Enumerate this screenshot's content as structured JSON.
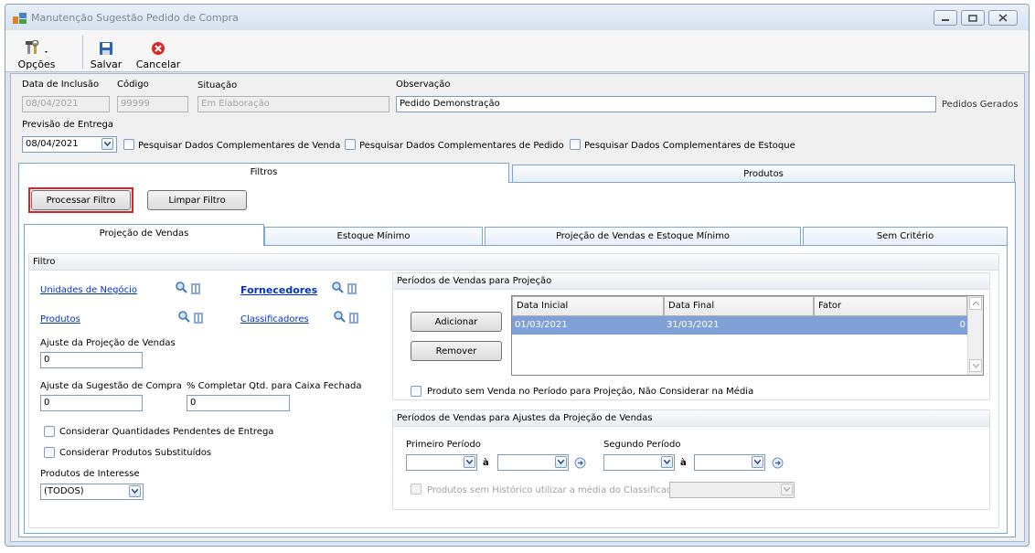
{
  "window": {
    "title": "Manutenção Sugestão Pedido de Compra"
  },
  "toolbar": {
    "options_label": "Opções",
    "save_label": "Salvar",
    "cancel_label": "Cancelar"
  },
  "header": {
    "inclusion_date_label": "Data de Inclusão",
    "inclusion_date_value": "08/04/2021",
    "code_label": "Código",
    "code_value": "99999",
    "status_label": "Situação",
    "status_value": "Em Elaboração",
    "observation_label": "Observação",
    "observation_value": "Pedido Demonstração",
    "generated_orders_label": "Pedidos Gerados",
    "delivery_forecast_label": "Previsão de Entrega",
    "delivery_forecast_value": "08/04/2021",
    "check_sales_label": "Pesquisar Dados Complementares de Venda",
    "check_order_label": "Pesquisar Dados Complementares de Pedido",
    "check_stock_label": "Pesquisar Dados Complementares de Estoque"
  },
  "main_tabs": [
    {
      "label": "Filtros"
    },
    {
      "label": "Produtos"
    }
  ],
  "filter_buttons": {
    "process_label": "Processar Filtro",
    "clear_label": "Limpar Filtro"
  },
  "sub_tabs": [
    {
      "label": "Projeção de Vendas"
    },
    {
      "label": "Estoque Mínimo"
    },
    {
      "label": "Projeção de Vendas e Estoque Mínimo"
    },
    {
      "label": "Sem Critério"
    }
  ],
  "filter": {
    "group_title": "Filtro",
    "business_units_link": "Unidades de Negócio",
    "suppliers_link": "Fornecedores",
    "products_link": "Produtos",
    "classifiers_link": "Classificadores",
    "sales_projection_adjust_label": "Ajuste da Projeção de Vendas",
    "sales_projection_adjust_value": "0",
    "purchase_suggestion_adjust_label": "Ajuste da Sugestão de Compra",
    "purchase_suggestion_adjust_value": "0",
    "complete_qty_label": "% Completar Qtd. para Caixa Fechada",
    "complete_qty_value": "0",
    "pending_delivery_label": "Considerar Quantidades Pendentes de Entrega",
    "substituted_label": "Considerar Produtos Substituídos",
    "products_interest_label": "Produtos de Interesse",
    "products_interest_value": "(TODOS)"
  },
  "periods": {
    "title": "Períodos de Vendas para Projeção",
    "add_label": "Adicionar",
    "remove_label": "Remover",
    "columns": [
      "Data Inicial",
      "Data Final",
      "Fator"
    ],
    "rows": [
      {
        "start": "01/03/2021",
        "end": "31/03/2021",
        "factor": "0"
      }
    ],
    "no_sales_label": "Produto sem Venda no Período para Projeção, Não Considerar na Média"
  },
  "adjust_periods": {
    "title": "Períodos de Vendas para Ajustes da Projeção de Vendas",
    "first_label": "Primeiro Período",
    "second_label": "Segundo Período",
    "to_label_1": "à",
    "to_label_2": "à",
    "no_history_label": "Produtos sem Histórico utilizar a média do Classificador"
  },
  "colors": {
    "accent": "#3399ff",
    "highlight_row": "#7fa1d8",
    "link": "#0033cc",
    "callout": "#e02020"
  }
}
